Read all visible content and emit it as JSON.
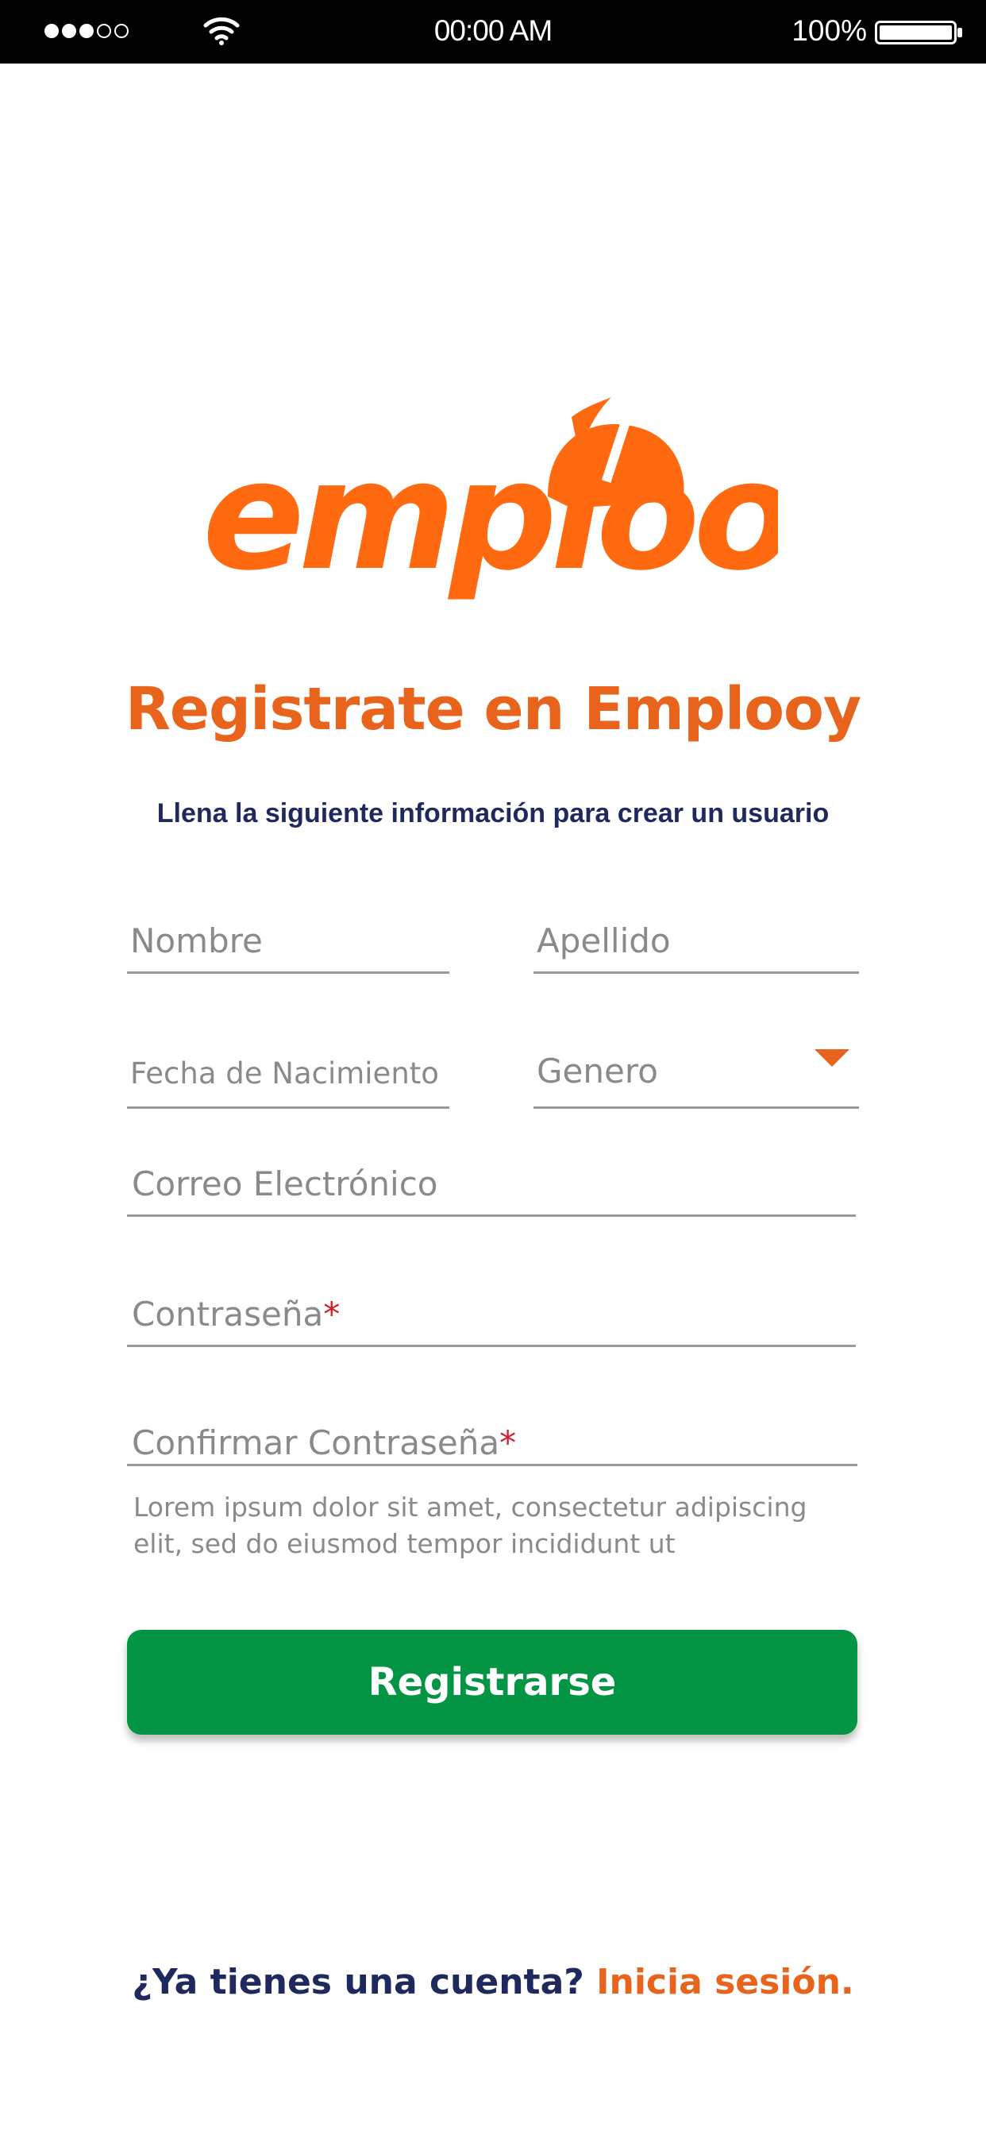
{
  "status_bar": {
    "time": "00:00 AM",
    "battery": "100%",
    "signal_icon": "signal-dots-icon",
    "wifi_icon": "wifi-icon",
    "battery_icon": "battery-icon"
  },
  "logo": {
    "text": "emplooy",
    "icon": "hard-hat-icon"
  },
  "title": "Registrate en Emplooy",
  "subtitle": "Llena la siguiente información para crear un usuario",
  "form": {
    "first_name_placeholder": "Nombre",
    "last_name_placeholder": "Apellido",
    "birthdate_placeholder": "Fecha de Nacimiento",
    "gender_placeholder": "Genero",
    "email_placeholder": "Correo Electrónico",
    "password_placeholder": "Contraseña",
    "confirm_password_placeholder": "Confirmar Contraseña",
    "required_mark": "*",
    "helper_text": "Lorem ipsum dolor sit amet, consectetur adipiscing elit, sed do eiusmod tempor incididunt ut"
  },
  "register_button": "Registrarse",
  "footer": {
    "question": "¿Ya tienes una cuenta?",
    "link": "Inicia sesión."
  },
  "colors": {
    "brand_orange": "#e8641c",
    "navy": "#1e2a5e",
    "button_green": "#049544",
    "required_red": "#d0202a"
  }
}
